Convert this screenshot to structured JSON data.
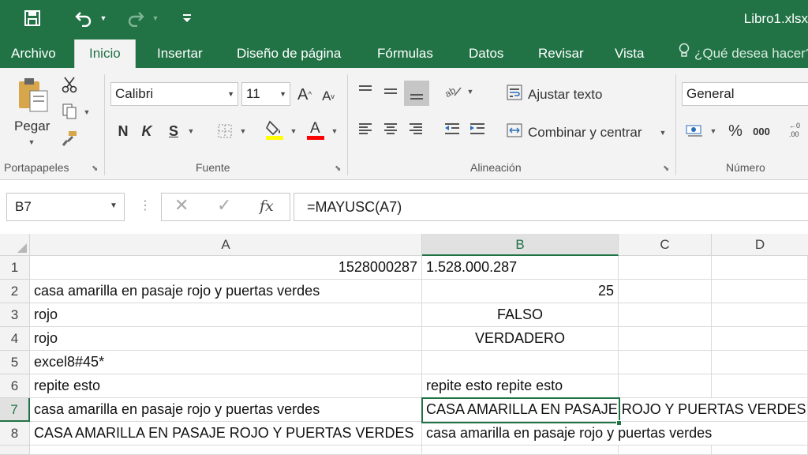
{
  "title_bar": {
    "document_title": "Libro1.xlsx",
    "icons": [
      "save-icon",
      "undo-icon",
      "redo-icon",
      "customize-qat-icon"
    ]
  },
  "tabs": [
    {
      "label": "Archivo"
    },
    {
      "label": "Inicio",
      "active": true
    },
    {
      "label": "Insertar"
    },
    {
      "label": "Diseño de página"
    },
    {
      "label": "Fórmulas"
    },
    {
      "label": "Datos"
    },
    {
      "label": "Revisar"
    },
    {
      "label": "Vista"
    }
  ],
  "tell_me": "¿Qué desea hacer?",
  "ribbon": {
    "clipboard": {
      "paste_label": "Pegar",
      "group_label": "Portapapeles"
    },
    "font": {
      "font_name": "Calibri",
      "font_size": "11",
      "bold": "N",
      "italic": "K",
      "underline": "S",
      "group_label": "Fuente"
    },
    "alignment": {
      "wrap_text": "Ajustar texto",
      "merge_center": "Combinar y centrar",
      "group_label": "Alineación"
    },
    "number": {
      "format": "General",
      "percent": "%",
      "thousands": "000",
      "group_label": "Número"
    }
  },
  "formula_bar": {
    "name_box": "B7",
    "formula": "=MAYUSC(A7)",
    "fx_label": "fx"
  },
  "columns": [
    "A",
    "B",
    "C",
    "D"
  ],
  "selected_column": "B",
  "selected_row": "7",
  "rows": [
    {
      "num": "1",
      "A": "1528000287",
      "B": "1.528.000.287"
    },
    {
      "num": "2",
      "A": "casa amarilla en pasaje rojo y puertas verdes",
      "B": "25"
    },
    {
      "num": "3",
      "A": "rojo",
      "B": "FALSO"
    },
    {
      "num": "4",
      "A": "rojo",
      "B": "VERDADERO"
    },
    {
      "num": "5",
      "A": "excel8#45*",
      "B": ""
    },
    {
      "num": "6",
      "A": "repite esto",
      "B": "repite esto repite esto"
    },
    {
      "num": "7",
      "A": "casa amarilla en pasaje rojo y puertas verdes",
      "B": "CASA AMARILLA EN PASAJE ROJO Y PUERTAS VERDES"
    },
    {
      "num": "8",
      "A": "CASA AMARILLA EN PASAJE ROJO Y PUERTAS VERDES",
      "B": "casa amarilla en pasaje rojo y puertas verdes"
    }
  ],
  "colors": {
    "brand_green": "#217346",
    "ribbon_bg": "#f3f3f3",
    "fill_highlight": "#ffff00",
    "font_color": "#ff0000"
  }
}
